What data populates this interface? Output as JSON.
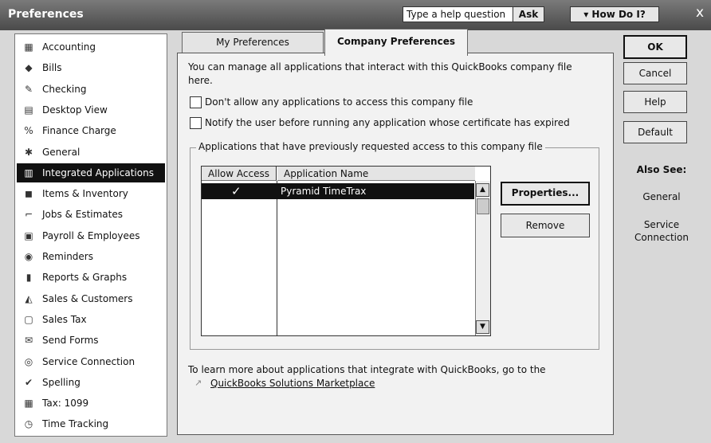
{
  "window": {
    "title": "Preferences",
    "help_placeholder": "Type a help question",
    "ask_label": "Ask",
    "howdoi_label": "How Do I?",
    "close_glyph": "x"
  },
  "sidebar": {
    "items": [
      {
        "label": "Accounting",
        "icon": "accounting-icon",
        "glyph": "▦"
      },
      {
        "label": "Bills",
        "icon": "bills-icon",
        "glyph": "◆"
      },
      {
        "label": "Checking",
        "icon": "checking-icon",
        "glyph": "✎"
      },
      {
        "label": "Desktop View",
        "icon": "desktop-view-icon",
        "glyph": "▤"
      },
      {
        "label": "Finance Charge",
        "icon": "finance-charge-icon",
        "glyph": "%"
      },
      {
        "label": "General",
        "icon": "general-icon",
        "glyph": "✱"
      },
      {
        "label": "Integrated Applications",
        "icon": "integrated-applications-icon",
        "glyph": "▥"
      },
      {
        "label": "Items & Inventory",
        "icon": "items-inventory-icon",
        "glyph": "◼"
      },
      {
        "label": "Jobs & Estimates",
        "icon": "jobs-estimates-icon",
        "glyph": "⌐"
      },
      {
        "label": "Payroll & Employees",
        "icon": "payroll-employees-icon",
        "glyph": "▣"
      },
      {
        "label": "Reminders",
        "icon": "reminders-icon",
        "glyph": "◉"
      },
      {
        "label": "Reports & Graphs",
        "icon": "reports-graphs-icon",
        "glyph": "▮"
      },
      {
        "label": "Sales & Customers",
        "icon": "sales-customers-icon",
        "glyph": "◭"
      },
      {
        "label": "Sales Tax",
        "icon": "sales-tax-icon",
        "glyph": "▢"
      },
      {
        "label": "Send Forms",
        "icon": "send-forms-icon",
        "glyph": "✉"
      },
      {
        "label": "Service Connection",
        "icon": "service-connection-icon",
        "glyph": "◎"
      },
      {
        "label": "Spelling",
        "icon": "spelling-icon",
        "glyph": "✔"
      },
      {
        "label": "Tax: 1099",
        "icon": "tax-1099-icon",
        "glyph": "▦"
      },
      {
        "label": "Time Tracking",
        "icon": "time-tracking-icon",
        "glyph": "◷"
      }
    ],
    "selected": "Integrated Applications"
  },
  "tabs": {
    "my_preferences": "My Preferences",
    "company_preferences": "Company Preferences"
  },
  "panel": {
    "intro_line1": "You can manage all applications that interact with this QuickBooks company file",
    "intro_line2": "here.",
    "checkbox_no_access": "Don't allow any applications to access this company file",
    "checkbox_notify": "Notify the user before running any application whose certificate has expired",
    "group_title": "Applications that have previously requested access to this company file",
    "columns": {
      "allow_access": "Allow Access",
      "application_name": "Application Name"
    },
    "rows": [
      {
        "allow_access": "✓",
        "application_name": "Pyramid TimeTrax"
      }
    ],
    "properties_label": "Properties...",
    "remove_label": "Remove",
    "footer_text": "To learn more about applications that integrate with QuickBooks, go to the",
    "footer_link": "QuickBooks Solutions Marketplace"
  },
  "buttons": {
    "ok": "OK",
    "cancel": "Cancel",
    "help": "Help",
    "default": "Default"
  },
  "also_see": {
    "title": "Also See:",
    "links": [
      "General",
      "Service Connection"
    ]
  }
}
